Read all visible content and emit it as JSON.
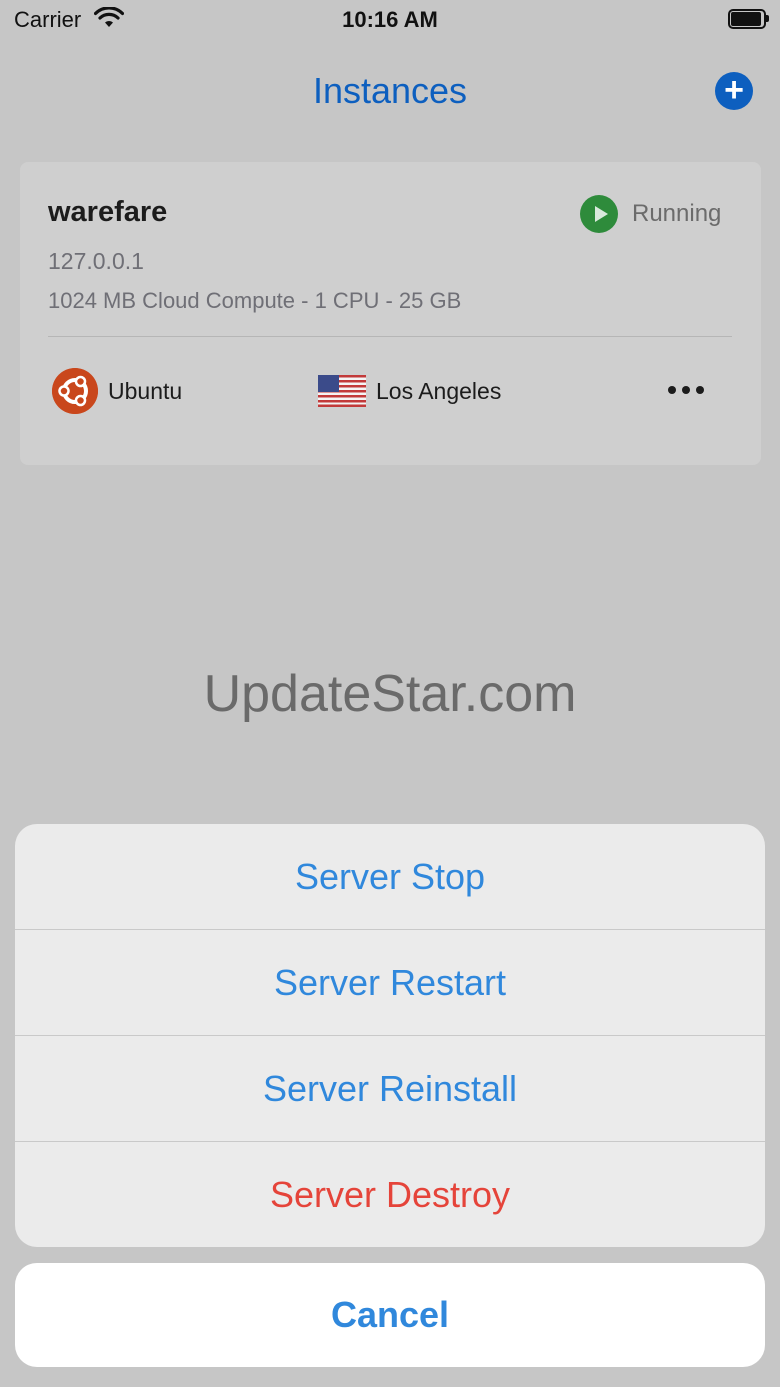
{
  "status_bar": {
    "carrier": "Carrier",
    "time": "10:16 AM"
  },
  "nav": {
    "title": "Instances",
    "add_icon": "plus-circle-icon"
  },
  "instance": {
    "name": "warefare",
    "status": "Running",
    "ip": "127.0.0.1",
    "specs": "1024 MB Cloud Compute - 1 CPU - 25 GB",
    "os": "Ubuntu",
    "location": "Los Angeles"
  },
  "watermark": "UpdateStar.com",
  "action_sheet": {
    "actions": [
      {
        "label": "Server Stop"
      },
      {
        "label": "Server Restart"
      },
      {
        "label": "Server Reinstall"
      },
      {
        "label": "Server Destroy"
      }
    ],
    "cancel_label": "Cancel"
  },
  "colors": {
    "accent": "#0d5fbf",
    "action_text": "#3088dc",
    "destructive": "#e5443a",
    "running": "#2e8b3b",
    "ubuntu": "#c9471c"
  }
}
